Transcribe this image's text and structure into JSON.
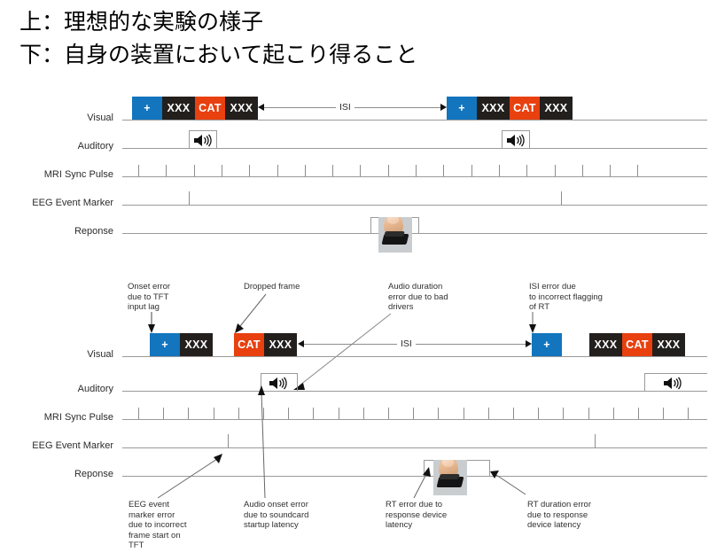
{
  "title": {
    "line1": "上：理想的な実験の様子",
    "line2": "下：自身の装置において起こり得ること"
  },
  "colors": {
    "blue": "#1275be",
    "black": "#221f1d",
    "red": "#e8400f",
    "line": "#9a9a9a",
    "text": "#2b2b2b"
  },
  "row_labels": {
    "visual": "Visual",
    "auditory": "Auditory",
    "mri": "MRI Sync Pulse",
    "eeg": "EEG Event Marker",
    "response": "Reponse"
  },
  "labels": {
    "isi": "ISI",
    "fixation": "+",
    "mask": "XXX",
    "target": "CAT"
  },
  "ideal_diagram": {
    "caption": "Top: ideal experiment timing",
    "visual_sequence_1": [
      {
        "label": "+",
        "color": "#1275be"
      },
      {
        "label": "XXX",
        "color": "#221f1d"
      },
      {
        "label": "CAT",
        "color": "#e8400f"
      },
      {
        "label": "XXX",
        "color": "#221f1d"
      }
    ],
    "visual_sequence_2": [
      {
        "label": "+",
        "color": "#1275be"
      },
      {
        "label": "XXX",
        "color": "#221f1d"
      },
      {
        "label": "CAT",
        "color": "#e8400f"
      },
      {
        "label": "XXX",
        "color": "#221f1d"
      }
    ],
    "isi_label": "ISI",
    "mri_pulse_count": 19,
    "eeg_marker_count": 2,
    "auditory_pulse_count": 2,
    "response_pulse_count": 1
  },
  "real_diagram": {
    "caption": "Bottom: what can happen on your own equipment",
    "visual_sequence_1": [
      {
        "label": "+",
        "color": "#1275be"
      },
      {
        "label": "XXX",
        "color": "#221f1d"
      }
    ],
    "visual_sequence_2": [
      {
        "label": "CAT",
        "color": "#e8400f"
      },
      {
        "label": "XXX",
        "color": "#221f1d"
      }
    ],
    "visual_sequence_3": [
      {
        "label": "+",
        "color": "#1275be"
      }
    ],
    "visual_sequence_4": [
      {
        "label": "XXX",
        "color": "#221f1d"
      },
      {
        "label": "CAT",
        "color": "#e8400f"
      },
      {
        "label": "XXX",
        "color": "#221f1d"
      }
    ],
    "isi_label": "ISI",
    "mri_pulse_count": 23,
    "eeg_marker_count": 2,
    "auditory_pulse_count": 2,
    "response_pulse_count": 1
  },
  "annotations_top": [
    {
      "id": "onset-error",
      "text": "Onset error\ndue to TFT\ninput lag"
    },
    {
      "id": "dropped-frame",
      "text": "Dropped frame"
    },
    {
      "id": "audio-duration-error",
      "text": "Audio duration\nerror due to bad\ndrivers"
    },
    {
      "id": "isi-error",
      "text": "ISI error due\nto incorrect flagging\nof RT"
    }
  ],
  "annotations_bottom": [
    {
      "id": "eeg-marker-error",
      "text": "EEG event\nmarker error\ndue to incorrect\nframe start on\nTFT"
    },
    {
      "id": "audio-onset-error",
      "text": "Audio onset error\ndue to soundcard\nstartup latency"
    },
    {
      "id": "rt-error",
      "text": "RT error due to\nresponse device\nlatency"
    },
    {
      "id": "rt-duration-error",
      "text": "RT duration error\ndue to response\ndevice latency"
    }
  ],
  "icons": {
    "speaker": "speaker-icon",
    "response_button": "finger-on-response-button-image"
  }
}
